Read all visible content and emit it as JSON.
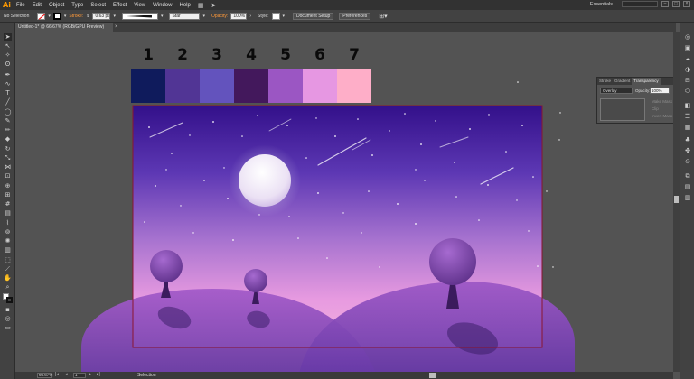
{
  "app": {
    "logo": "Ai",
    "menu": [
      "File",
      "Edit",
      "Object",
      "Type",
      "Select",
      "Effect",
      "View",
      "Window",
      "Help"
    ],
    "workspace": "Essentials"
  },
  "control_bar": {
    "selection": "No Selection",
    "stroke_label": "Stroke:",
    "stroke_weight": "0.63 pt",
    "brush": "Star",
    "opacity_label": "Opacity:",
    "opacity_value": "100%",
    "style_label": "Style:",
    "document_setup": "Document Setup",
    "preferences": "Preferences"
  },
  "document": {
    "tab_title": "Untitled-1* @ 66.67% (RGB/GPU Preview)"
  },
  "status": {
    "zoom": "66.67%",
    "artboard": "1",
    "mode": "Selection"
  },
  "transparency_panel": {
    "tabs": [
      "Stroke",
      "Gradient",
      "Transparency"
    ],
    "blend_mode": "Overlay",
    "opacity_label": "Opacity:",
    "opacity_value": "100%",
    "make_mask": "Make Mask",
    "clip": "Clip",
    "invert_mask": "Invert Mask"
  },
  "palette": [
    {
      "label": "1",
      "color": "#0f1b5c"
    },
    {
      "label": "2",
      "color": "#513595"
    },
    {
      "label": "3",
      "color": "#6353bd"
    },
    {
      "label": "4",
      "color": "#43185c"
    },
    {
      "label": "5",
      "color": "#9b56c3"
    },
    {
      "label": "6",
      "color": "#e697e2"
    },
    {
      "label": "7",
      "color": "#feaec8"
    }
  ]
}
